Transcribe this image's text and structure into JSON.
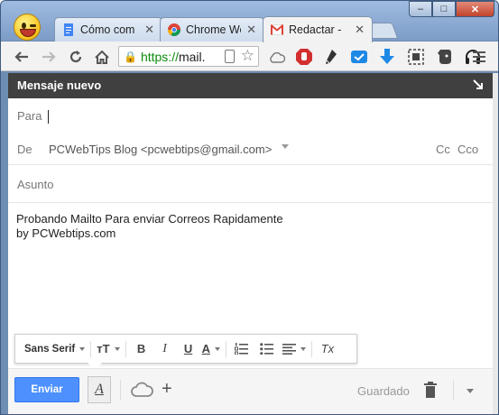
{
  "browser": {
    "tabs": [
      {
        "label": "Cómo com",
        "icon": "docs-icon"
      },
      {
        "label": "Chrome We",
        "icon": "chrome-icon"
      },
      {
        "label": "Redactar - ",
        "icon": "gmail-icon"
      }
    ],
    "close_glyph": "✕",
    "url_scheme": "https://",
    "url_rest": "mail.",
    "window_controls": {
      "minimize": "–",
      "maximize": "□",
      "close": "✕"
    }
  },
  "compose": {
    "header_title": "Mensaje nuevo",
    "to_label": "Para",
    "from_label": "De",
    "from_value": "PCWebTips Blog <pcwebtips@gmail.com>",
    "cc_label": "Cc",
    "bcc_label": "Cco",
    "subject_placeholder": "Asunto",
    "body_lines": [
      "Probando Mailto Para enviar Correos Rapidamente",
      "by PCWebtips.com"
    ],
    "formatting": {
      "font": "Sans Serif",
      "size_glyph": "тT",
      "bold": "B",
      "italic": "I",
      "underline": "U",
      "text_color": "A",
      "clear": "Tx"
    },
    "send_label": "Enviar",
    "saved_label": "Guardado",
    "format_toggle": "A"
  },
  "colors": {
    "send_button": "#4d90fe",
    "header_bg": "#404040",
    "titlebar": "#7c9cc7"
  }
}
